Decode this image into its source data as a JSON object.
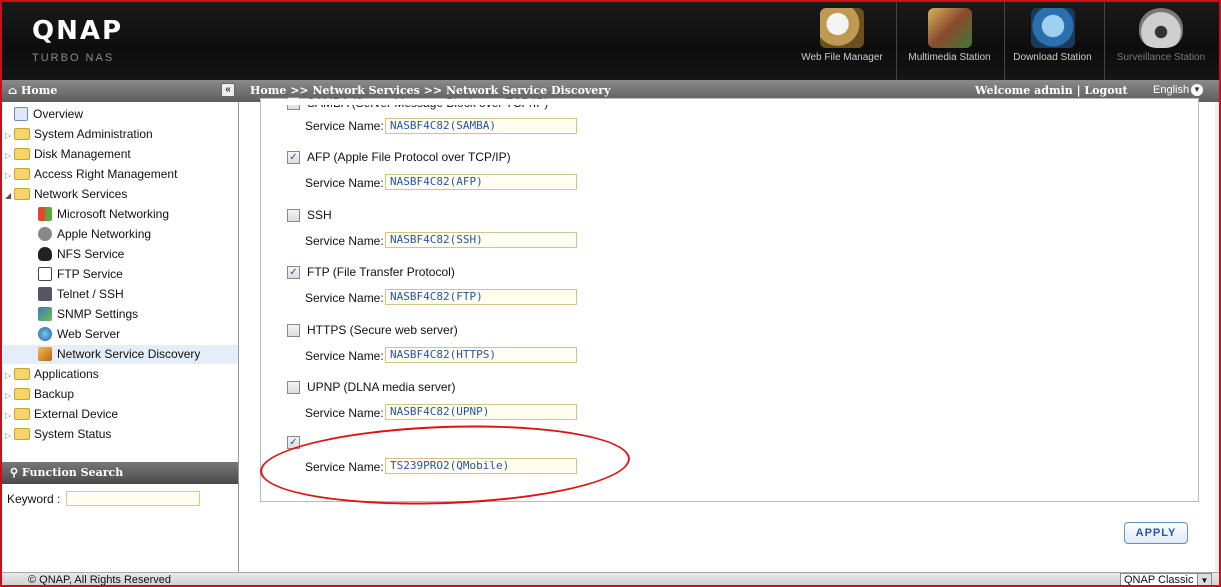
{
  "header": {
    "logo": "QNAP",
    "logo_sub": "TURBO NAS",
    "stations": [
      {
        "label": "Web File Manager",
        "icon": "file-manager-icon"
      },
      {
        "label": "Multimedia Station",
        "icon": "multimedia-icon"
      },
      {
        "label": "Download Station",
        "icon": "download-icon"
      },
      {
        "label": "Surveillance Station",
        "icon": "camera-icon"
      }
    ]
  },
  "navbar": {
    "home": "Home",
    "collapse": "«",
    "breadcrumb": "Home >> Network Services >> Network Service Discovery",
    "welcome": "Welcome admin | Logout",
    "language": "English"
  },
  "sidebar": {
    "items": [
      {
        "label": "Overview"
      },
      {
        "label": "System Administration"
      },
      {
        "label": "Disk Management"
      },
      {
        "label": "Access Right Management"
      },
      {
        "label": "Network Services"
      },
      {
        "label": "Microsoft Networking"
      },
      {
        "label": "Apple Networking"
      },
      {
        "label": "NFS Service"
      },
      {
        "label": "FTP Service"
      },
      {
        "label": "Telnet / SSH"
      },
      {
        "label": "SNMP Settings"
      },
      {
        "label": "Web Server"
      },
      {
        "label": "Network Service Discovery"
      },
      {
        "label": "Applications"
      },
      {
        "label": "Backup"
      },
      {
        "label": "External Device"
      },
      {
        "label": "System Status"
      }
    ],
    "function_search": "Function Search",
    "keyword_label": "Keyword :",
    "keyword_value": ""
  },
  "main": {
    "top_clipped": "SAMBA (Server Message Block over TCP/IP)",
    "service_name_label": "Service Name:",
    "services": [
      {
        "label": "SAMBA (Server Message Block over TCP/IP)",
        "checked": false,
        "value": "NASBF4C82(SAMBA)"
      },
      {
        "label": "AFP (Apple File Protocol over TCP/IP)",
        "checked": true,
        "value": "NASBF4C82(AFP)"
      },
      {
        "label": "SSH",
        "checked": false,
        "value": "NASBF4C82(SSH)"
      },
      {
        "label": "FTP (File Transfer Protocol)",
        "checked": true,
        "value": "NASBF4C82(FTP)"
      },
      {
        "label": "HTTPS (Secure web server)",
        "checked": false,
        "value": "NASBF4C82(HTTPS)"
      },
      {
        "label": "UPNP (DLNA media server)",
        "checked": false,
        "value": "NASBF4C82(UPNP)"
      },
      {
        "label": "",
        "checked": true,
        "value": "TS239PRO2(QMobile)"
      }
    ],
    "apply": "APPLY"
  },
  "footer": {
    "copyright": "© QNAP, All Rights Reserved",
    "theme": "QNAP Classic"
  },
  "colors": {
    "frame": "#c8101a",
    "annotation": "#dd1111",
    "link_blue": "#2855a8"
  }
}
